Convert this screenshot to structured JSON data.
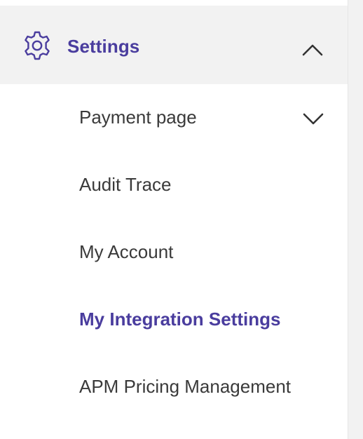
{
  "sidebar": {
    "section": {
      "title": "Settings",
      "icon": "gear-icon",
      "toggle_icon": "chevron-up-icon",
      "expanded": true,
      "accent_color": "#4a3d9e"
    },
    "items": [
      {
        "label": "Payment page",
        "has_submenu": true,
        "submenu_icon": "chevron-down-icon",
        "active": false
      },
      {
        "label": "Audit Trace",
        "active": false
      },
      {
        "label": "My Account",
        "active": false
      },
      {
        "label": "My Integration Settings",
        "active": true
      },
      {
        "label": "APM Pricing Management",
        "active": false
      }
    ]
  }
}
